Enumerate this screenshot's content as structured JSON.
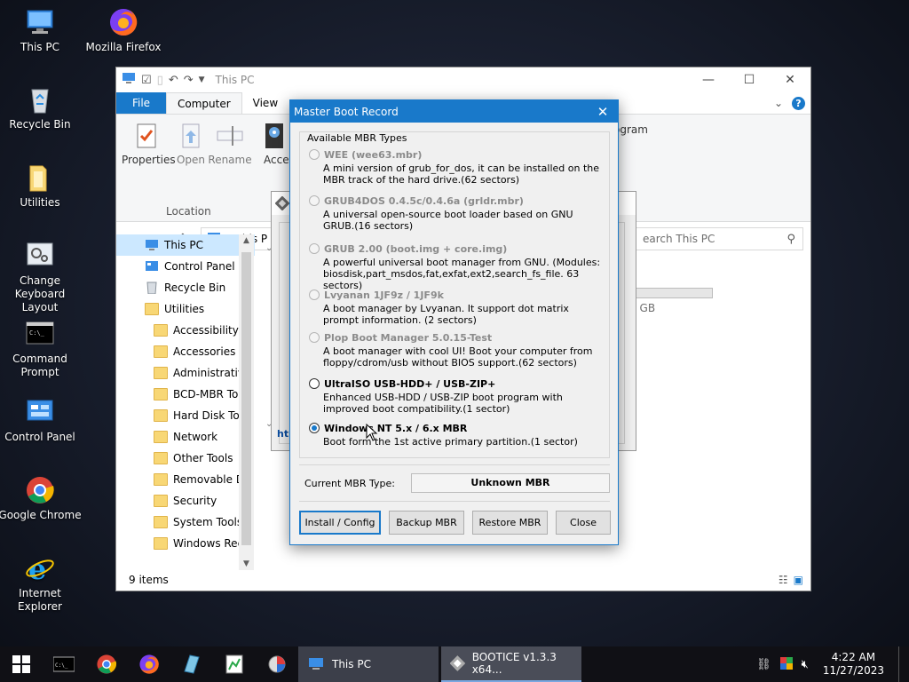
{
  "desktop": {
    "icons": [
      {
        "label": "This PC"
      },
      {
        "label": "Mozilla Firefox"
      },
      {
        "label": "Recycle Bin"
      },
      {
        "label": "Utilities"
      },
      {
        "label": "Change Keyboard Layout"
      },
      {
        "label": "Command Prompt"
      },
      {
        "label": "Control Panel"
      },
      {
        "label": "Google Chrome"
      },
      {
        "label": "Internet Explorer"
      }
    ]
  },
  "explorer": {
    "title": "This PC",
    "tabs": {
      "file": "File",
      "computer": "Computer",
      "view": "View"
    },
    "ribbon": {
      "properties": "Properties",
      "open": "Open",
      "rename": "Rename",
      "access_media": "Access media",
      "location_group": "Location",
      "program": "ogram"
    },
    "address": "This P",
    "search_placeholder": "earch This PC",
    "nav_items": [
      "This PC",
      "Control Panel",
      "Recycle Bin",
      "Utilities",
      "Accessibility",
      "Accessories",
      "Administrative",
      "BCD-MBR Tool",
      "Hard Disk Tools",
      "Network",
      "Other Tools",
      "Removable Dri",
      "Security",
      "System Tools",
      "Windows Reco"
    ],
    "status": "9 items",
    "drive_size": "0.98 GB"
  },
  "bootice_back": {
    "tab_text": "ht"
  },
  "mbr_dialog": {
    "title": "Master Boot Record",
    "group_label": "Available MBR Types",
    "options": [
      {
        "name": "WEE (wee63.mbr)",
        "desc": "A mini version of grub_for_dos, it can be installed on the MBR track of the hard drive.(62 sectors)",
        "enabled": false,
        "selected": false
      },
      {
        "name": "GRUB4DOS 0.4.5c/0.4.6a (grldr.mbr)",
        "desc": "A universal open-source boot loader based on GNU GRUB.(16 sectors)",
        "enabled": false,
        "selected": false
      },
      {
        "name": "GRUB 2.00 (boot.img + core.img)",
        "desc": "A powerful universal boot manager from GNU. (Modules: biosdisk,part_msdos,fat,exfat,ext2,search_fs_file. 63 sectors)",
        "enabled": false,
        "selected": false
      },
      {
        "name": "Lvyanan 1JF9z / 1JF9k",
        "desc": "A boot manager by Lvyanan. It support dot matrix prompt information. (2 sectors)",
        "enabled": false,
        "selected": false
      },
      {
        "name": "Plop Boot Manager 5.0.15-Test",
        "desc": "A boot manager with cool UI! Boot your computer from floppy/cdrom/usb without BIOS support.(62 sectors)",
        "enabled": false,
        "selected": false
      },
      {
        "name": "UltraISO USB-HDD+ / USB-ZIP+",
        "desc": "Enhanced USB-HDD / USB-ZIP boot program with improved boot compatibility.(1 sector)",
        "enabled": true,
        "selected": false
      },
      {
        "name": "Windows NT 5.x / 6.x MBR",
        "desc": "Boot form the 1st active primary partition.(1 sector)",
        "enabled": true,
        "selected": true
      }
    ],
    "current_label": "Current MBR Type:",
    "current_value": "Unknown MBR",
    "buttons": {
      "install": "Install / Config",
      "backup": "Backup MBR",
      "restore": "Restore MBR",
      "close": "Close"
    }
  },
  "taskbar": {
    "tasks": [
      {
        "label": "This PC"
      },
      {
        "label": "BOOTICE v1.3.3 x64..."
      }
    ],
    "time": "4:22 AM",
    "date": "11/27/2023"
  }
}
